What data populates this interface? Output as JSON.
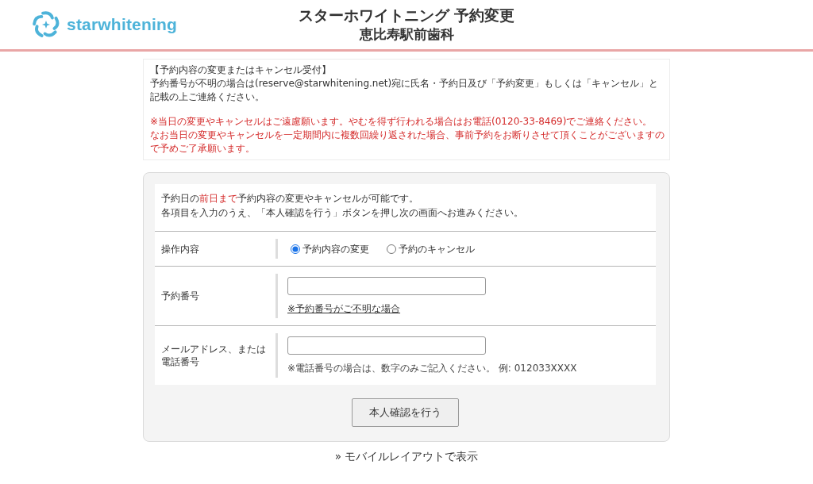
{
  "header": {
    "logo_text": "starwhitening",
    "title": "スターホワイトニング 予約変更",
    "subtitle": "恵比寿駅前歯科"
  },
  "notice": {
    "heading": "【予約内容の変更またはキャンセル受付】",
    "paragraphs": [
      {
        "kind": "normal",
        "lines": [
          "予約番号が不明の場合は(reserve@starwhitening.net)宛に氏名・予約日及び「予約変更」もしくは「キャンセル」と",
          "記載の上ご連絡ください。"
        ]
      },
      {
        "kind": "warning",
        "lines": [
          "※当日の変更やキャンセルはご遠慮願います。やむを得ず行われる場合はお電話(0120-33-8469)でご連絡ください。",
          "なお当日の変更やキャンセルを一定期間内に複数回繰り返された場合、事前予約をお断りさせて頂くことがございますので予めご了承願います。"
        ]
      }
    ]
  },
  "form": {
    "intro": [
      [
        {
          "text": "予約日の",
          "highlight": false
        },
        {
          "text": "前日まで",
          "highlight": true
        },
        {
          "text": "予約内容の変更やキャンセルが可能です。",
          "highlight": false
        }
      ],
      [
        {
          "text": "各項目を入力のうえ、「本人確認を行う」ボタンを押し次の画面へお進みください。",
          "highlight": false
        }
      ]
    ],
    "rows": [
      {
        "kind": "radio",
        "label": "操作内容",
        "options": [
          {
            "label": "予約内容の変更",
            "selected": true
          },
          {
            "label": "予約のキャンセル",
            "selected": false
          }
        ]
      },
      {
        "kind": "text",
        "label": "予約番号",
        "link": "※予約番号がご不明な場合"
      },
      {
        "kind": "text",
        "label": "メールアドレス、または電話番号",
        "hint": "※電話番号の場合は、数字のみご記入ください。 例: 012033XXXX"
      }
    ],
    "submit_button": "本人確認を行う"
  },
  "footer_link": "» モバイルレイアウトで表示"
}
